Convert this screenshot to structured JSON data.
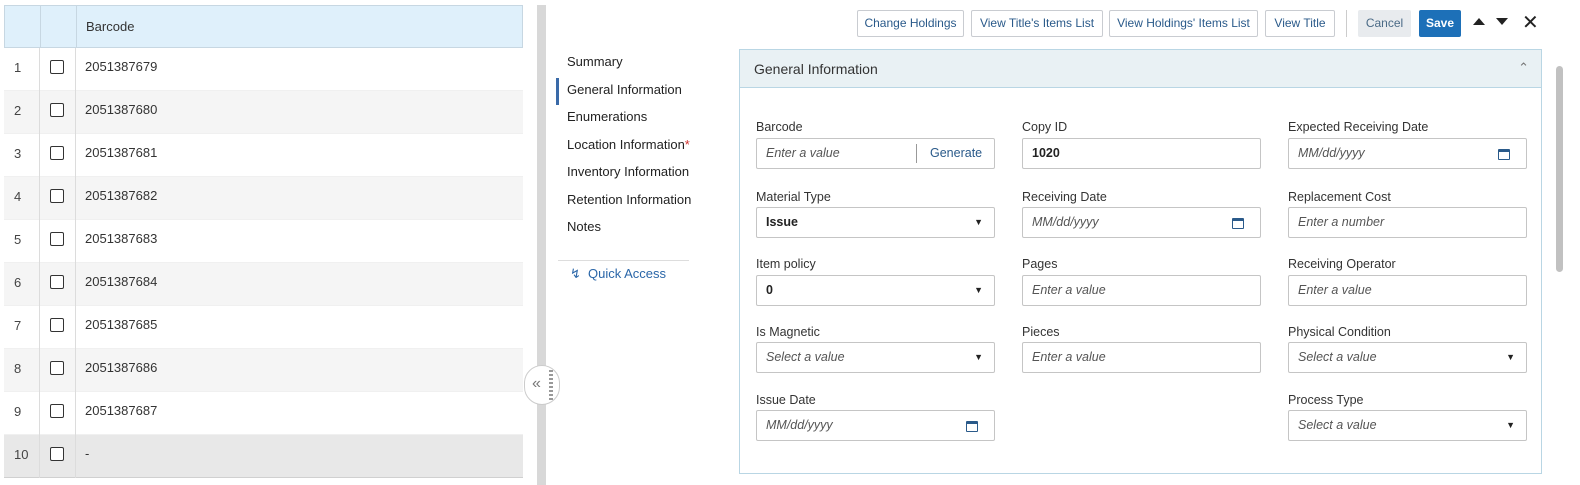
{
  "table": {
    "column_header": "Barcode",
    "rows": [
      {
        "num": "1",
        "barcode": "2051387679"
      },
      {
        "num": "2",
        "barcode": "2051387680"
      },
      {
        "num": "3",
        "barcode": "2051387681"
      },
      {
        "num": "4",
        "barcode": "2051387682"
      },
      {
        "num": "5",
        "barcode": "2051387683"
      },
      {
        "num": "6",
        "barcode": "2051387684"
      },
      {
        "num": "7",
        "barcode": "2051387685"
      },
      {
        "num": "8",
        "barcode": "2051387686"
      },
      {
        "num": "9",
        "barcode": "2051387687"
      },
      {
        "num": "10",
        "barcode": "-"
      }
    ]
  },
  "toolbar": {
    "change_holdings": "Change Holdings",
    "view_titles_items": "View Title's Items List",
    "view_holdings_items": "View Holdings' Items List",
    "view_title": "View Title",
    "cancel": "Cancel",
    "save": "Save"
  },
  "nav": {
    "items": [
      "Summary",
      "General Information",
      "Enumerations",
      "Location Information",
      "Inventory Information",
      "Retention Information",
      "Notes"
    ],
    "active": "General Information",
    "required_mark": "*",
    "quick_access": "Quick Access"
  },
  "section": {
    "title": "General Information",
    "barcode": {
      "label": "Barcode",
      "placeholder": "Enter a value",
      "generate": "Generate"
    },
    "copy_id": {
      "label": "Copy ID",
      "value": "1020"
    },
    "expected_receiving_date": {
      "label": "Expected Receiving Date",
      "placeholder": "MM/dd/yyyy"
    },
    "material_type": {
      "label": "Material Type",
      "value": "Issue"
    },
    "receiving_date": {
      "label": "Receiving Date",
      "placeholder": "MM/dd/yyyy"
    },
    "replacement_cost": {
      "label": "Replacement Cost",
      "placeholder": "Enter a number"
    },
    "item_policy": {
      "label": "Item policy",
      "value": "0"
    },
    "pages": {
      "label": "Pages",
      "placeholder": "Enter a value"
    },
    "receiving_operator": {
      "label": "Receiving Operator",
      "placeholder": "Enter a value"
    },
    "is_magnetic": {
      "label": "Is Magnetic",
      "placeholder": "Select a value"
    },
    "pieces": {
      "label": "Pieces",
      "placeholder": "Enter a value"
    },
    "physical_condition": {
      "label": "Physical Condition",
      "placeholder": "Select a value"
    },
    "issue_date": {
      "label": "Issue Date",
      "placeholder": "MM/dd/yyyy"
    },
    "process_type": {
      "label": "Process Type",
      "placeholder": "Select a value"
    }
  },
  "icons": {
    "collapse": "double-chevron-left-icon",
    "close": "close-icon",
    "calendar": "calendar-icon",
    "dropdown": "caret-down-icon",
    "quick_access": "lightning-icon"
  }
}
